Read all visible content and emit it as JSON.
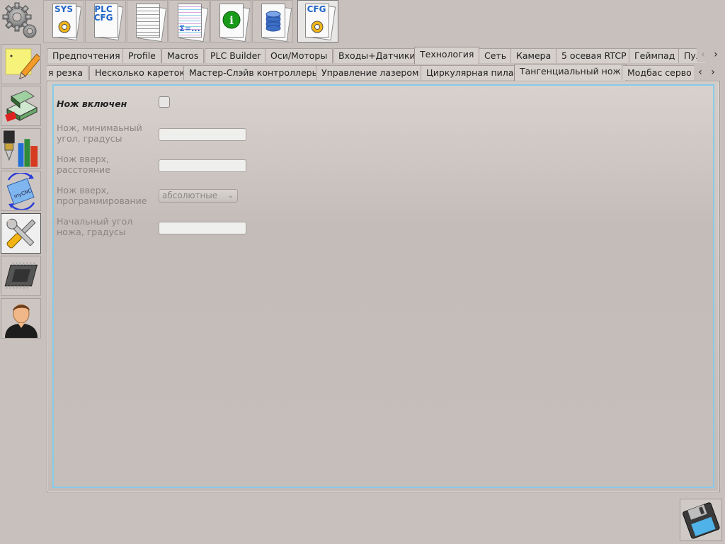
{
  "top_toolbar": {
    "items": [
      {
        "icon": "sys-gear-doc-icon",
        "label": "SYS"
      },
      {
        "icon": "plc-cfg-doc-icon",
        "label": "PLC CFG"
      },
      {
        "icon": "text-document-icon",
        "label": ""
      },
      {
        "icon": "formula-document-icon",
        "label": "Σ=..."
      },
      {
        "icon": "info-document-icon",
        "label": ""
      },
      {
        "icon": "database-document-icon",
        "label": ""
      },
      {
        "icon": "cfg-gear-doc-icon",
        "label": "CFG"
      }
    ]
  },
  "left_toolbar": {
    "items": [
      {
        "icon": "settings-gears-icon"
      },
      {
        "icon": "note-pencil-icon"
      },
      {
        "icon": "books-icon"
      },
      {
        "icon": "tools-library-icon"
      },
      {
        "icon": "mycnc-refresh-icon",
        "label": "myCNC"
      },
      {
        "icon": "wrench-screwdriver-icon"
      },
      {
        "icon": "chip-icon"
      },
      {
        "icon": "user-icon"
      }
    ]
  },
  "tabs_row1": {
    "items": [
      "Предпочтения",
      "Profile",
      "Macros",
      "PLC Builder",
      "Оси/Моторы",
      "Входы+Датчики",
      "Технология",
      "Сеть",
      "Камера",
      "5 осевая RTCP",
      "Геймпад",
      "Пул"
    ],
    "active": "Технология"
  },
  "tabs_row2": {
    "items": [
      "я резка",
      "Несколько кареток",
      "Мастер-Слэйв контроллеры",
      "Управление лазером",
      "Циркулярная пила",
      "Тангенциальный нож",
      "Модбас серво"
    ],
    "active": "Тангенциальный нож"
  },
  "form": {
    "enabled_label": "Нож включен",
    "enabled_checked": false,
    "min_angle_label": "Нож, минимаьный угол, градусы",
    "min_angle_value": "",
    "up_distance_label": "Нож вверх, расстояние",
    "up_distance_value": "",
    "up_programming_label": "Нож вверх, программирование",
    "up_programming_value": "абсолютные",
    "start_angle_label": "Начальный угол ножа, градусы",
    "start_angle_value": ""
  },
  "colors": {
    "background": "#c8c0bc",
    "panel_border_accent": "#86cbe8",
    "doc_label_blue": "#1f63c6"
  }
}
